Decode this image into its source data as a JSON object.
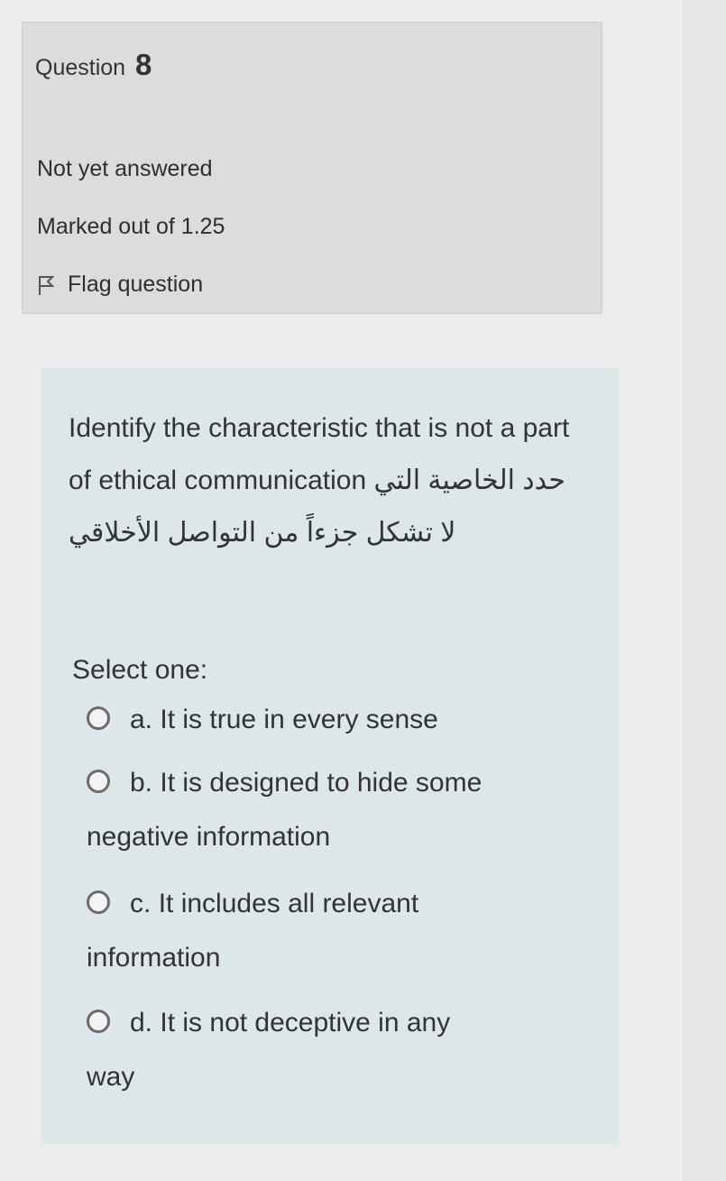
{
  "info": {
    "question_label": "Question",
    "question_number": "8",
    "state": "Not yet answered",
    "grade": "Marked out of 1.25",
    "flag_label": "Flag question"
  },
  "question": {
    "text_en": "Identify the characteristic that is not a part of ethical communication",
    "text_ar": "حدد الخاصية التي لا تشكل جزءاً من التواصل الأخلاقي",
    "select_label": "Select one:",
    "options": [
      {
        "letter": "a.",
        "line1": "It is true in every sense",
        "line2": ""
      },
      {
        "letter": "b.",
        "line1": "It is designed to hide some",
        "line2": "negative information"
      },
      {
        "letter": "c.",
        "line1": "It includes all relevant",
        "line2": "information"
      },
      {
        "letter": "d.",
        "line1": "It is not deceptive in any",
        "line2": "way"
      }
    ]
  },
  "colors": {
    "info_bg": "#dcdcdc",
    "content_bg": "#dde6e8",
    "text": "#333333"
  },
  "icons": {
    "flag": "flag-icon",
    "radio": "radio-unchecked-icon"
  }
}
